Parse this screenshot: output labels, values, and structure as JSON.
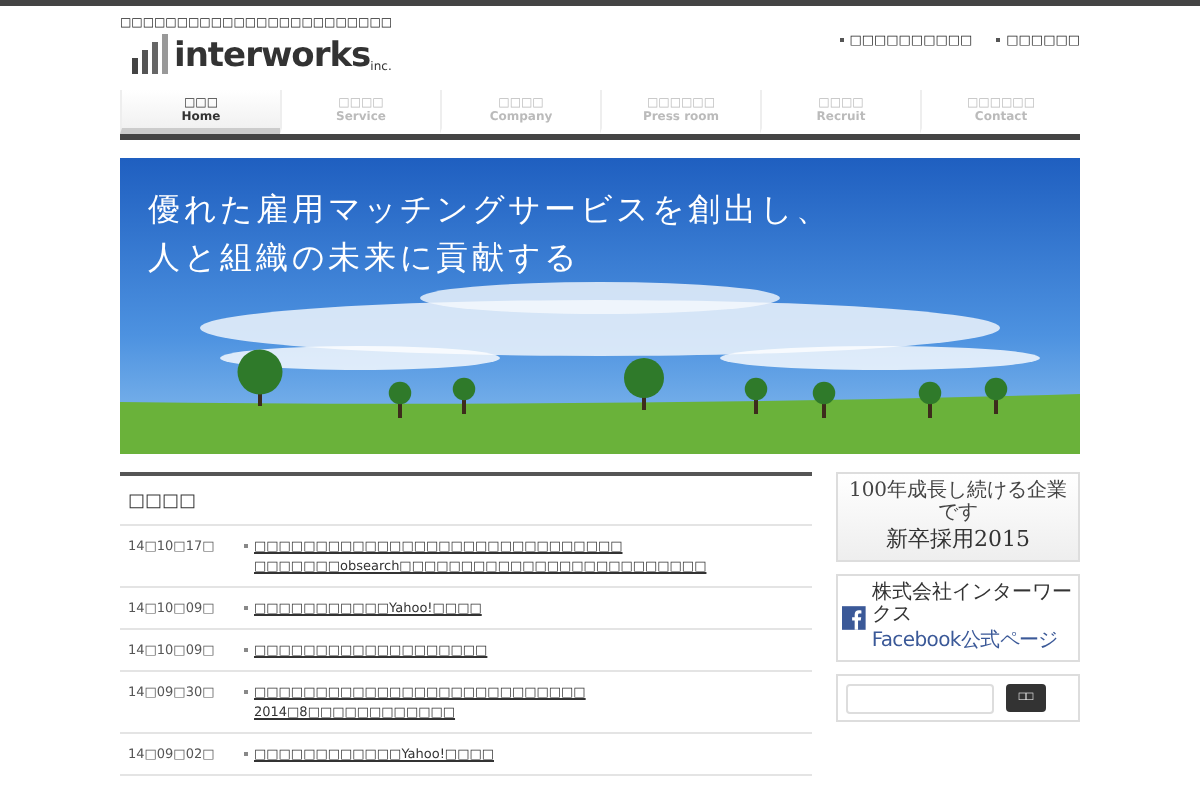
{
  "header": {
    "tagline": "□□□□□□□□□□□□□□□□□□□□□□□□",
    "logo": {
      "name": "interworks",
      "suffix": "inc."
    },
    "links": [
      "□□□□□□□□□□",
      "□□□□□□"
    ]
  },
  "nav": [
    {
      "label": "□□□",
      "sublabel": "Home",
      "selected": true
    },
    {
      "label": "□□□□",
      "sublabel": "Service",
      "selected": false
    },
    {
      "label": "□□□□",
      "sublabel": "Company",
      "selected": false
    },
    {
      "label": "□□□□□□",
      "sublabel": "Press room",
      "selected": false
    },
    {
      "label": "□□□□",
      "sublabel": "Recruit",
      "selected": false
    },
    {
      "label": "□□□□□□",
      "sublabel": "Contact",
      "selected": false
    }
  ],
  "hero": {
    "lines": [
      "優れた雇用マッチングサービスを創出し、",
      "人と組織の未来に貢献する"
    ]
  },
  "news": {
    "title": "□□□□",
    "items": [
      {
        "date": "14□10□17□",
        "lines": [
          "□□□□□□□□□□□□□□□□□□□□□□□□□□□□□□",
          "□□□□□□□obsearch□□□□□□□□□□□□□□□□□□□□□□□□□"
        ]
      },
      {
        "date": "14□10□09□",
        "lines": [
          "□□□□□□□□□□□Yahoo!□□□□"
        ]
      },
      {
        "date": "14□10□09□",
        "lines": [
          "□□□□□□□□□□□□□□□□□□□"
        ]
      },
      {
        "date": "14□09□30□",
        "lines": [
          "□□□□□□□□□□□□□□□□□□□□□□□□□□□",
          "2014□8□□□□□□□□□□□□"
        ]
      },
      {
        "date": "14□09□02□",
        "lines": [
          "□□□□□□□□□□□□Yahoo!□□□□"
        ]
      }
    ]
  },
  "sidebar": {
    "recruit_banner": {
      "caption": "100年成長し続ける企業です",
      "title": "新卒採用2015"
    },
    "facebook_banner": {
      "caption": "株式会社インターワークス",
      "title": "Facebook公式ページ"
    },
    "search": {
      "button": "□□"
    }
  }
}
